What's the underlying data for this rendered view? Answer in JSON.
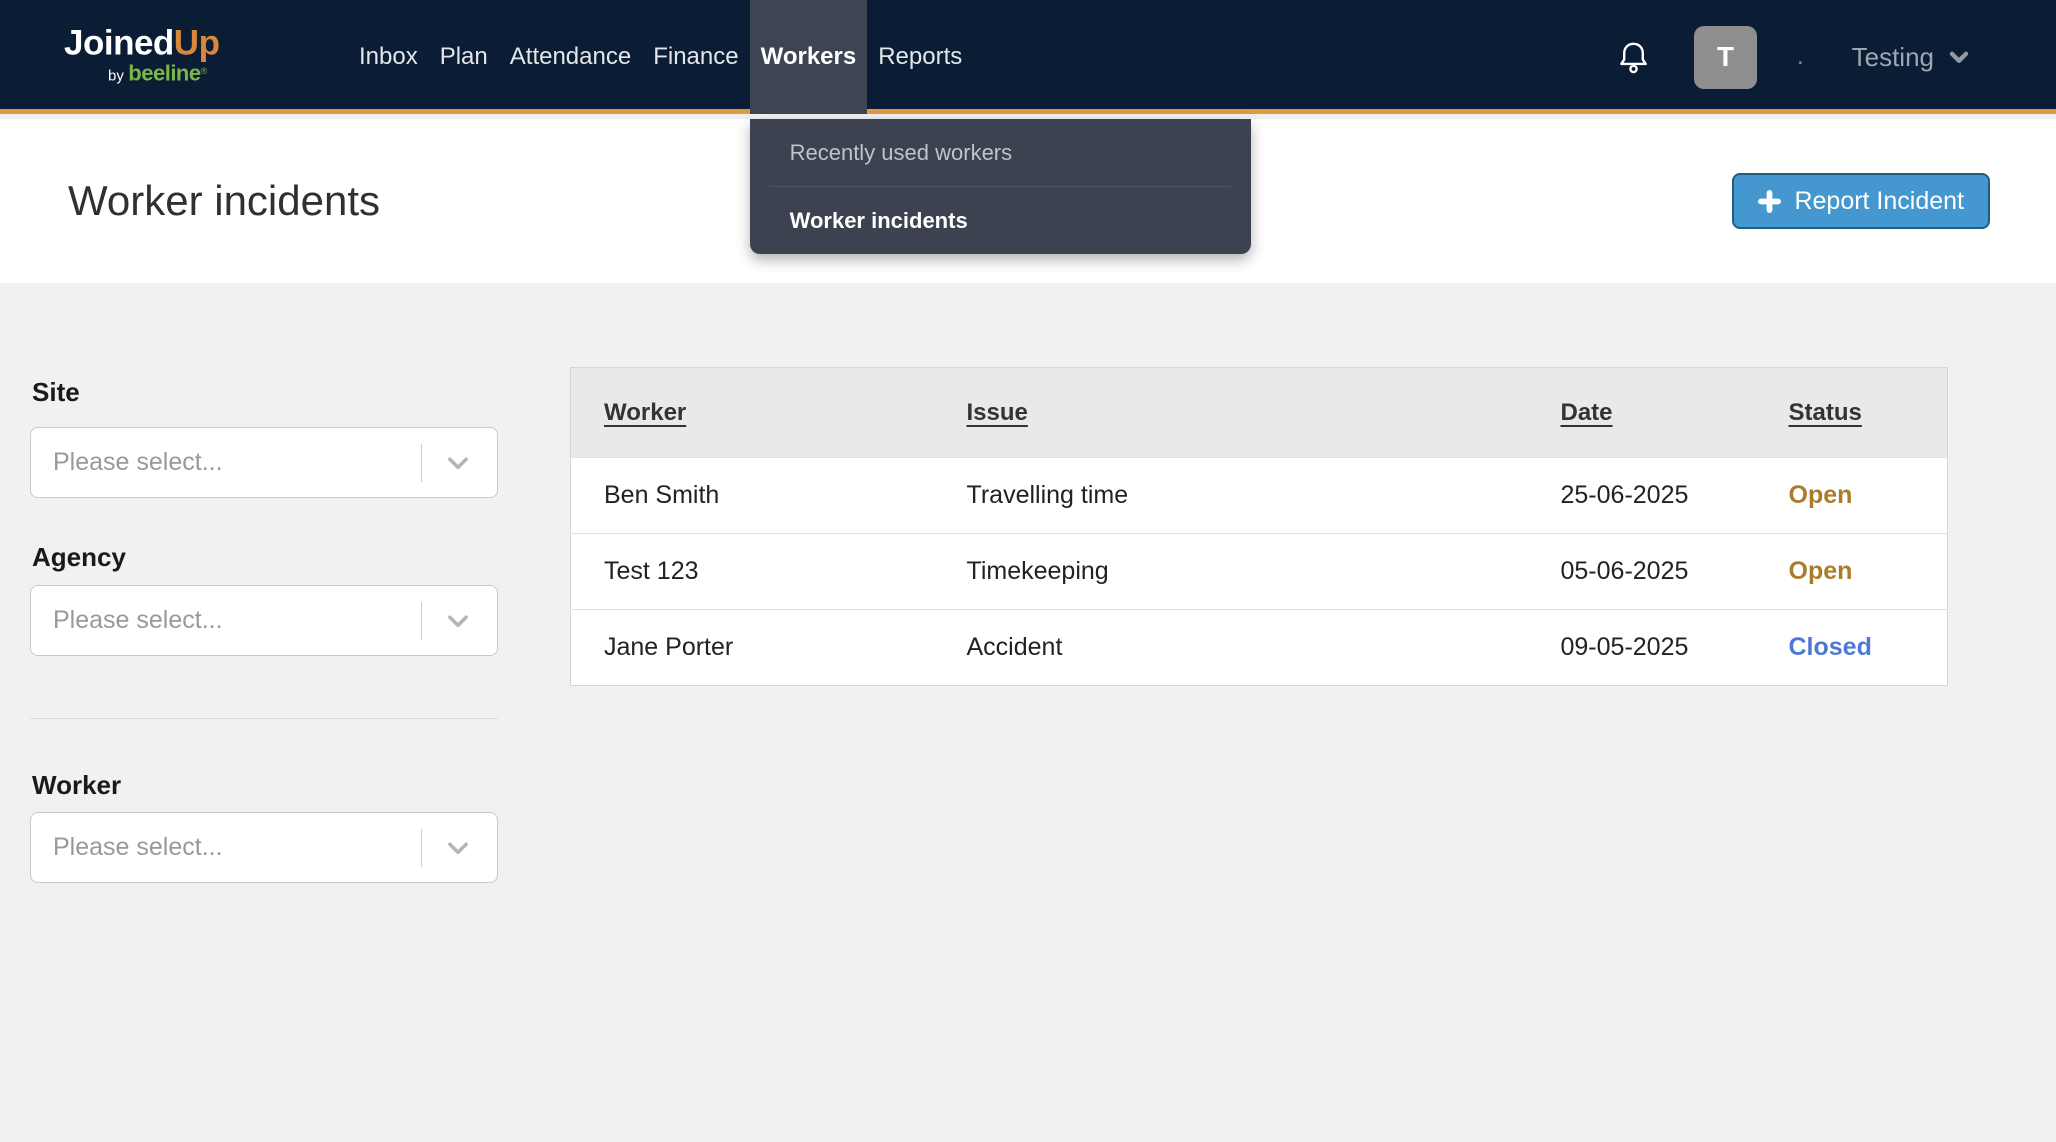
{
  "brand": {
    "part1": "Joined",
    "part2": "Up",
    "by": "by",
    "byline": "beeline",
    "registered": "®"
  },
  "nav": {
    "items": [
      {
        "label": "Inbox"
      },
      {
        "label": "Plan"
      },
      {
        "label": "Attendance"
      },
      {
        "label": "Finance"
      },
      {
        "label": "Workers"
      },
      {
        "label": "Reports"
      }
    ],
    "active_item": "Workers"
  },
  "navbar_right": {
    "avatar_initial": "T",
    "separator": ".",
    "account_name": "Testing"
  },
  "workers_menu": {
    "items": [
      {
        "label": "Recently used workers"
      },
      {
        "label": "Worker incidents"
      }
    ]
  },
  "page": {
    "title": "Worker incidents",
    "report_button_label": "Report Incident"
  },
  "filters": {
    "groups": [
      {
        "label": "Site",
        "placeholder": "Please select..."
      },
      {
        "label": "Agency",
        "placeholder": "Please select..."
      },
      {
        "label": "Worker",
        "placeholder": "Please select..."
      }
    ]
  },
  "incidents_table": {
    "columns": [
      {
        "label": "Worker"
      },
      {
        "label": "Issue"
      },
      {
        "label": "Date"
      },
      {
        "label": "Status"
      }
    ],
    "rows": [
      {
        "worker": "Ben Smith",
        "issue": "Travelling time",
        "date": "25-06-2025",
        "status": "Open"
      },
      {
        "worker": "Test 123",
        "issue": "Timekeeping",
        "date": "05-06-2025",
        "status": "Open"
      },
      {
        "worker": "Jane Porter",
        "issue": "Accident",
        "date": "09-05-2025",
        "status": "Closed"
      }
    ],
    "status_colors": {
      "Open": "#ab7d2b",
      "Closed": "#4d79d6"
    }
  },
  "colors": {
    "navbar_bg": "#0a1d35",
    "accent_orange": "#e09a3d",
    "active_nav_bg": "#3d4452",
    "dropdown_bg": "#3c4250",
    "button_blue": "#4498cf",
    "button_border": "#1f5f7d",
    "brand_orange": "#d9883b",
    "brand_green": "#7ab648",
    "status_open": "#ab7d2b",
    "status_closed": "#4d79d6"
  }
}
